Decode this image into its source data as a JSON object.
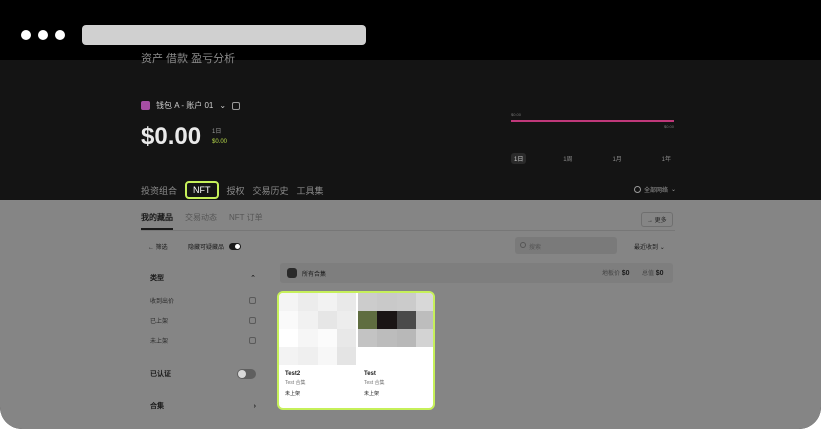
{
  "top": {
    "nav_cut": "资产  借款  盈亏分析",
    "account": "钱包 A - 账户 01",
    "balance": "$0.00",
    "period": "1日",
    "change": "$0.00",
    "chart_label_left": "$0.00",
    "chart_label_right": "$0.00",
    "ranges": [
      "1日",
      "1周",
      "1月",
      "1年"
    ],
    "tabs": [
      "投资组合",
      "NFT",
      "授权",
      "交易历史",
      "工具集"
    ],
    "network": "全部网络"
  },
  "main": {
    "subtabs": [
      "我的藏品",
      "交易动态",
      "NFT 订单"
    ],
    "more": "更多",
    "filter": "筛选",
    "hide_label": "隐藏可疑藏品",
    "search_placeholder": "搜索",
    "sort": "最近收到",
    "filter_type": "类型",
    "filter_items": [
      "收到出价",
      "已上架",
      "未上架"
    ],
    "verified": "已认证",
    "collection": "合集",
    "all_collections": "所有合集",
    "floor_label": "地板价",
    "floor_value": "$0",
    "total_label": "总值",
    "total_value": "$0",
    "cards": [
      {
        "name": "Test2",
        "sub": "Test 合集",
        "status": "未上架"
      },
      {
        "name": "Test",
        "sub": "Test 合集",
        "status": "未上架"
      }
    ]
  },
  "colors": {
    "accent": "#c6f05a",
    "chart_line": "#c0387a",
    "positive": "#b7d94a"
  }
}
